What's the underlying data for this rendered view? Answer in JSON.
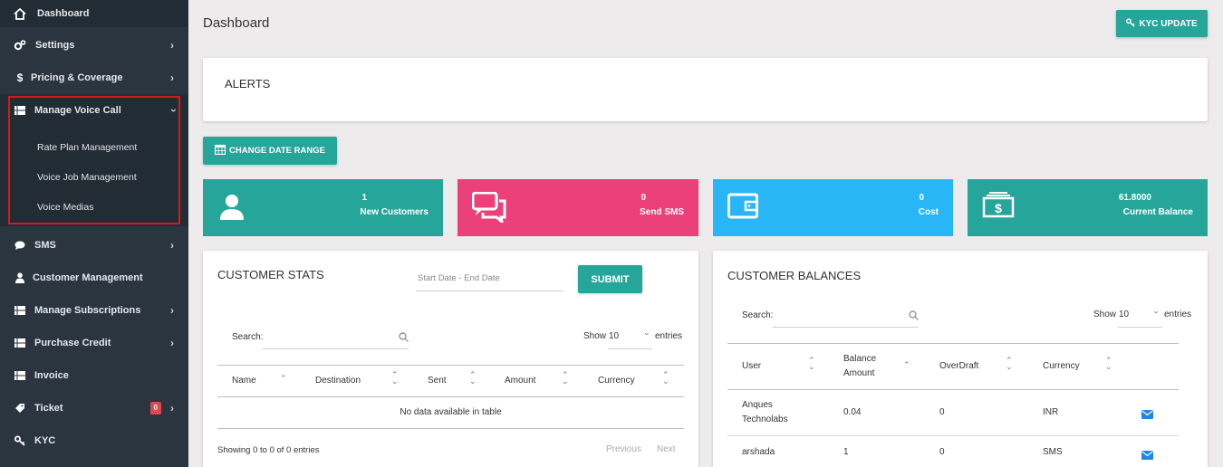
{
  "sidebar": {
    "items": [
      {
        "label": "Dashboard",
        "icon": "home-icon"
      },
      {
        "label": "Settings",
        "icon": "gears-icon"
      },
      {
        "label": "Pricing & Coverage",
        "icon": "dollar-icon"
      },
      {
        "label": "Manage Voice Call",
        "icon": "list-icon"
      },
      {
        "label": "SMS",
        "icon": "chat-icon"
      },
      {
        "label": "Customer Management",
        "icon": "user-icon"
      },
      {
        "label": "Manage Subscriptions",
        "icon": "list-icon"
      },
      {
        "label": "Purchase Credit",
        "icon": "list-icon"
      },
      {
        "label": "Invoice",
        "icon": "list-icon"
      },
      {
        "label": "Ticket",
        "icon": "tag-icon",
        "badge": "0"
      },
      {
        "label": "KYC",
        "icon": "key-icon"
      }
    ],
    "voice_submenu": [
      "Rate Plan Management",
      "Voice Job Management",
      "Voice Medias"
    ]
  },
  "header": {
    "title": "Dashboard",
    "kyc_button": "KYC UPDATE"
  },
  "alerts": {
    "title": "ALERTS"
  },
  "change_date_button": "CHANGE DATE RANGE",
  "stats": [
    {
      "value": "1",
      "label": "New Customers",
      "color": "#26a69a",
      "icon": "user-icon"
    },
    {
      "value": "0",
      "label": "Send SMS",
      "color": "#ec407a",
      "icon": "chat-icon"
    },
    {
      "value": "0",
      "label": "Cost",
      "color": "#29b6f6",
      "icon": "wallet-icon"
    },
    {
      "value": "61.8000",
      "label": "Current Balance",
      "color": "#26a69a",
      "icon": "money-icon"
    }
  ],
  "customer_stats": {
    "title": "CUSTOMER STATS",
    "date_placeholder": "Start Date - End Date",
    "submit": "SUBMIT",
    "search_label": "Search:",
    "show_label": "Show",
    "show_value": "10",
    "entries_label": "entries",
    "columns": [
      "Name",
      "Destination",
      "Sent",
      "Amount",
      "Currency"
    ],
    "empty_text": "No data available in table",
    "info": "Showing 0 to 0 of 0 entries",
    "prev": "Previous",
    "next": "Next"
  },
  "customer_balances": {
    "title": "CUSTOMER BALANCES",
    "search_label": "Search:",
    "show_label": "Show",
    "show_value": "10",
    "entries_label": "entries",
    "columns": [
      "User",
      "Balance Amount",
      "OverDraft",
      "Currency"
    ],
    "balance_col_line1": "Balance",
    "balance_col_line2": "Amount",
    "rows": [
      {
        "user_line1": "Anques",
        "user_line2": "Technolabs",
        "balance": "0.04",
        "overdraft": "0",
        "currency": "INR"
      },
      {
        "user_line1": "arshada",
        "user_line2": "",
        "balance": "1",
        "overdraft": "0",
        "currency": "SMS"
      }
    ]
  }
}
